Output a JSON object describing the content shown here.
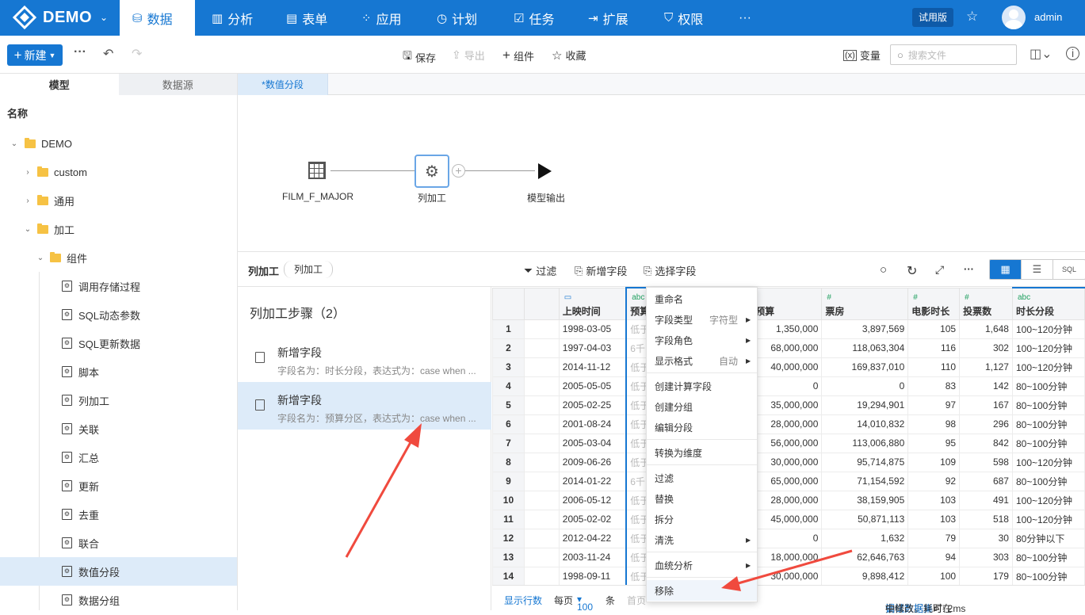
{
  "topnav": {
    "logo": "DEMO",
    "items": [
      {
        "label": "数据",
        "icon": "database-icon"
      },
      {
        "label": "分析",
        "icon": "bar-chart-icon"
      },
      {
        "label": "表单",
        "icon": "form-icon"
      },
      {
        "label": "应用",
        "icon": "apps-icon"
      },
      {
        "label": "计划",
        "icon": "clock-icon"
      },
      {
        "label": "任务",
        "icon": "task-icon"
      },
      {
        "label": "扩展",
        "icon": "extension-icon"
      },
      {
        "label": "权限",
        "icon": "shield-icon"
      }
    ],
    "more": "···",
    "trial": "试用版",
    "user": "admin"
  },
  "toolbar": {
    "new_label": "新建",
    "save": "保存",
    "export": "导出",
    "component": "组件",
    "favorite": "收藏",
    "variable": "变量",
    "search_placeholder": "搜索文件"
  },
  "left": {
    "tab_model": "模型",
    "tab_source": "数据源",
    "title": "名称",
    "tree": [
      {
        "label": "DEMO"
      },
      {
        "label": "custom"
      },
      {
        "label": "通用"
      },
      {
        "label": "加工"
      },
      {
        "label": "组件"
      },
      {
        "label": "调用存储过程"
      },
      {
        "label": "SQL动态参数"
      },
      {
        "label": "SQL更新数据"
      },
      {
        "label": "脚本"
      },
      {
        "label": "列加工"
      },
      {
        "label": "关联"
      },
      {
        "label": "汇总"
      },
      {
        "label": "更新"
      },
      {
        "label": "去重"
      },
      {
        "label": "联合"
      },
      {
        "label": "数值分段"
      },
      {
        "label": "数据分组"
      }
    ]
  },
  "tab": {
    "label": "*数值分段"
  },
  "flow": {
    "source": "FILM_F_MAJOR",
    "process": "列加工",
    "output": "模型输出"
  },
  "subbar": {
    "title": "列加工",
    "pill": "列加工",
    "filter": "过滤",
    "add_field": "新增字段",
    "select_field": "选择字段"
  },
  "steps": {
    "title": "列加工步骤（2）",
    "items": [
      {
        "name": "新增字段",
        "desc": "字段名为：时长分段，表达式为：case when ..."
      },
      {
        "name": "新增字段",
        "desc": "字段名为：预算分区，表达式为：case when ..."
      }
    ]
  },
  "grid": {
    "headers": [
      {
        "label": "上映时间",
        "type": "📅"
      },
      {
        "label": "预算",
        "type": "abc"
      },
      {
        "label": "预算",
        "type": "#"
      },
      {
        "label": "票房",
        "type": "#"
      },
      {
        "label": "电影时长",
        "type": "#"
      },
      {
        "label": "投票数",
        "type": "#"
      },
      {
        "label": "时长分段",
        "type": "abc"
      }
    ],
    "rows": [
      [
        "1",
        "1998-03-05",
        "低于",
        "1,350,000",
        "3,897,569",
        "105",
        "1,648",
        "100~120分钟"
      ],
      [
        "2",
        "1997-04-03",
        "6千",
        "68,000,000",
        "118,063,304",
        "116",
        "302",
        "100~120分钟"
      ],
      [
        "3",
        "2014-11-12",
        "低于",
        "40,000,000",
        "169,837,010",
        "110",
        "1,127",
        "100~120分钟"
      ],
      [
        "4",
        "2005-05-05",
        "低于",
        "0",
        "0",
        "83",
        "142",
        "80~100分钟"
      ],
      [
        "5",
        "2005-02-25",
        "低于",
        "35,000,000",
        "19,294,901",
        "97",
        "167",
        "80~100分钟"
      ],
      [
        "6",
        "2001-08-24",
        "低于",
        "28,000,000",
        "14,010,832",
        "98",
        "296",
        "80~100分钟"
      ],
      [
        "7",
        "2005-03-04",
        "低于",
        "56,000,000",
        "113,006,880",
        "95",
        "842",
        "80~100分钟"
      ],
      [
        "8",
        "2009-06-26",
        "低于",
        "30,000,000",
        "95,714,875",
        "109",
        "598",
        "100~120分钟"
      ],
      [
        "9",
        "2014-01-22",
        "6千",
        "65,000,000",
        "71,154,592",
        "92",
        "687",
        "80~100分钟"
      ],
      [
        "10",
        "2006-05-12",
        "低于",
        "28,000,000",
        "38,159,905",
        "103",
        "491",
        "100~120分钟"
      ],
      [
        "11",
        "2005-02-02",
        "低于",
        "45,000,000",
        "50,871,113",
        "103",
        "518",
        "100~120分钟"
      ],
      [
        "12",
        "2012-04-22",
        "低于",
        "0",
        "1,632",
        "79",
        "30",
        "80分钟以下"
      ],
      [
        "13",
        "2003-11-24",
        "低于",
        "18,000,000",
        "62,646,763",
        "94",
        "303",
        "80~100分钟"
      ],
      [
        "14",
        "1998-09-11",
        "低于",
        "30,000,000",
        "9,898,412",
        "100",
        "179",
        "80~100分钟"
      ]
    ]
  },
  "footer": {
    "show_rows": "显示行数",
    "per_page": "每页",
    "per_page_value": "100",
    "unit": "条",
    "first": "首页",
    "note_prefix": "抽样数据，可在",
    "note_link": "调试数据集",
    "note_suffix": "中修改。耗时: 2ms"
  },
  "menu": {
    "rename": "重命名",
    "field_type": "字段类型",
    "field_type_value": "字符型",
    "field_role": "字段角色",
    "display_format": "显示格式",
    "display_format_value": "自动",
    "create_calc": "创建计算字段",
    "create_group": "创建分组",
    "edit_segment": "编辑分段",
    "to_dimension": "转换为维度",
    "filter": "过滤",
    "replace": "替换",
    "split": "拆分",
    "clean": "清洗",
    "lineage": "血统分析",
    "remove": "移除"
  },
  "colors": {
    "primary": "#1677d2",
    "selected_bg": "#ddebf9",
    "arrow": "#f04a3e"
  }
}
